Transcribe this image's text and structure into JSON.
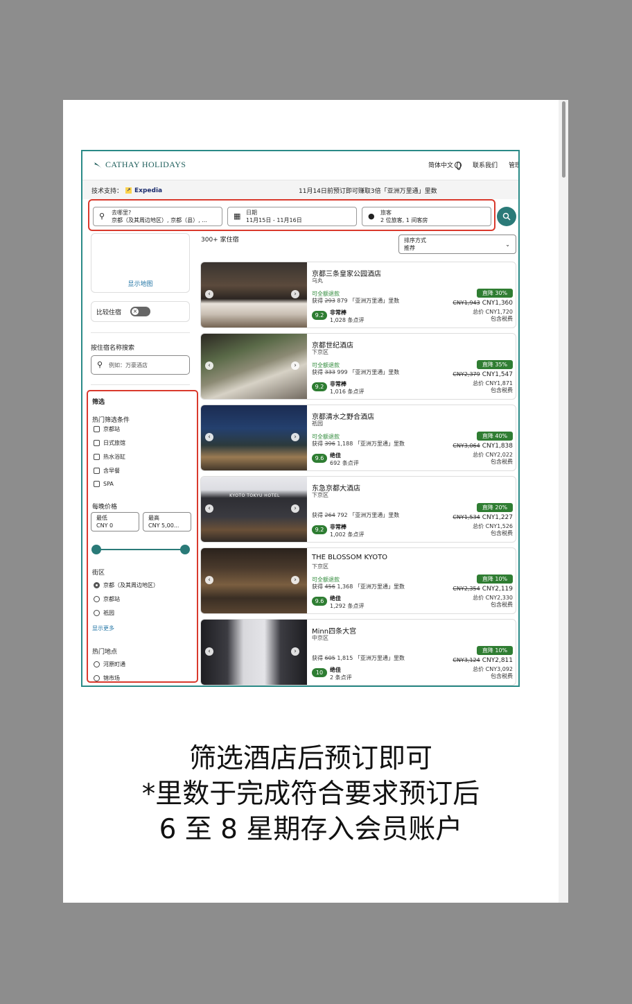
{
  "header": {
    "logo_text": "CATHAY HOLIDAYS",
    "language": "简体中文",
    "contact": "联系我们",
    "manage": "管理"
  },
  "subbar": {
    "powered_label": "技术支持：",
    "powered_brand": "Expedia",
    "promo": "11月14日前预订即可赚取3倍「亚洲万里通」里数"
  },
  "search": {
    "destination_label": "去哪里?",
    "destination_value": "京都（及其周边地区）, 京都（县）, ...",
    "dates_label": "日期",
    "dates_value": "11月15日 - 11月16日",
    "travelers_label": "旅客",
    "travelers_value": "2 位旅客, 1 间客房"
  },
  "sidebar": {
    "show_map": "显示地图",
    "compare": "比较住宿",
    "name_search_title": "按住宿名称搜索",
    "name_search_placeholder": "例如：万豪酒店",
    "filter_title": "筛选",
    "popular_title": "热门筛选条件",
    "popular": [
      "京都站",
      "日式旅馆",
      "热水浴缸",
      "含早餐",
      "SPA"
    ],
    "price_title": "每晚价格",
    "price_min_label": "最低",
    "price_min_value": "CNY 0",
    "price_max_label": "最高",
    "price_max_value": "CNY 5,00...",
    "district_title": "街区",
    "districts": [
      "京都（及其周边地区）",
      "京都站",
      "祇园"
    ],
    "show_more": "显示更多",
    "landmarks_title": "热门地点",
    "landmarks": [
      "河原町通",
      "锦市场"
    ]
  },
  "results": {
    "count": "300+ 家住宿",
    "sort_label": "排序方式",
    "sort_value": "推荐",
    "hotels": [
      {
        "name": "京都三条皇家公园酒店",
        "area": "乌丸",
        "refund": "可全额退款",
        "miles_prefix": "获得",
        "miles_old": "293",
        "miles_new": "879",
        "miles_suffix": "「亚洲万里通」里数",
        "score": "9.2",
        "rating": "非常棒",
        "reviews": "1,028 条点评",
        "badge": "直降 30%",
        "old_price": "CNY1,943",
        "price": "CNY1,360",
        "total": "总价 CNY1,720",
        "taxes": "包含税费"
      },
      {
        "name": "京都世纪酒店",
        "area": "下京区",
        "refund": "可全额退款",
        "miles_prefix": "获得",
        "miles_old": "333",
        "miles_new": "999",
        "miles_suffix": "「亚洲万里通」里数",
        "score": "9.2",
        "rating": "非常棒",
        "reviews": "1,016 条点评",
        "badge": "直降 35%",
        "old_price": "CNY2,379",
        "price": "CNY1,547",
        "total": "总价 CNY1,871",
        "taxes": "包含税费"
      },
      {
        "name": "京都清水之野合酒店",
        "area": "祇园",
        "refund": "可全额退款",
        "miles_prefix": "获得",
        "miles_old": "396",
        "miles_new": "1,188",
        "miles_suffix": "「亚洲万里通」里数",
        "score": "9.6",
        "rating": "绝佳",
        "reviews": "692 条点评",
        "badge": "直降 40%",
        "old_price": "CNY3,064",
        "price": "CNY1,838",
        "total": "总价 CNY2,022",
        "taxes": "包含税费"
      },
      {
        "name": "东急京都大酒店",
        "area": "下京区",
        "refund": "",
        "miles_prefix": "获得",
        "miles_old": "264",
        "miles_new": "792",
        "miles_suffix": "「亚洲万里通」里数",
        "score": "9.2",
        "rating": "非常棒",
        "reviews": "1,002 条点评",
        "badge": "直降 20%",
        "old_price": "CNY1,534",
        "price": "CNY1,227",
        "total": "总价 CNY1,526",
        "taxes": "包含税费"
      },
      {
        "name": "THE BLOSSOM KYOTO",
        "area": "下京区",
        "refund": "可全额退款",
        "miles_prefix": "获得",
        "miles_old": "456",
        "miles_new": "1,368",
        "miles_suffix": "「亚洲万里通」里数",
        "score": "9.6",
        "rating": "绝佳",
        "reviews": "1,292 条点评",
        "badge": "直降 10%",
        "old_price": "CNY2,354",
        "price": "CNY2,119",
        "total": "总价 CNY2,330",
        "taxes": "包含税费"
      },
      {
        "name": "Minn四条大宫",
        "area": "中京区",
        "refund": "",
        "miles_prefix": "获得",
        "miles_old": "605",
        "miles_new": "1,815",
        "miles_suffix": "「亚洲万里通」里数",
        "score": "10",
        "rating": "绝佳",
        "reviews": "2 条点评",
        "badge": "直降 10%",
        "old_price": "CNY3,124",
        "price": "CNY2,811",
        "total": "总价 CNY3,092",
        "taxes": "包含税费"
      }
    ]
  },
  "hotel_sign": "KYOTO TOKYU HOTEL",
  "caption": {
    "line1": "筛选酒店后预订即可",
    "line2": "*里数于完成符合要求预订后",
    "line3": "6 至 8 星期存入会员账户"
  },
  "colors": {
    "teal": "#2a7a78",
    "highlight_red": "#d9392c",
    "deal_green": "#2f7d32"
  }
}
